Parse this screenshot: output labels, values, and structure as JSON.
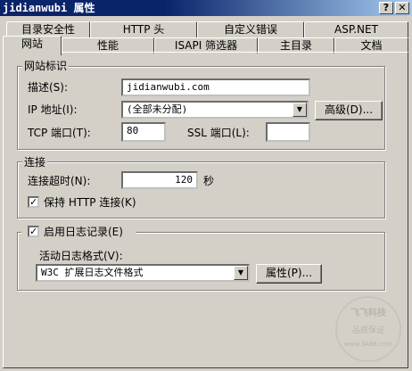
{
  "window": {
    "title": "jidianwubi 属性",
    "help_glyph": "?",
    "close_glyph": "✕"
  },
  "tabs_back": [
    "目录安全性",
    "HTTP 头",
    "自定义错误",
    "ASP.NET"
  ],
  "tabs_front": [
    "网站",
    "性能",
    "ISAPI 筛选器",
    "主目录",
    "文档"
  ],
  "website_id": {
    "legend": "网站标识",
    "desc_label": "描述(S):",
    "desc_value": "jidianwubi.com",
    "ip_label": "IP 地址(I):",
    "ip_value": "(全部未分配)",
    "advanced_button": "高级(D)...",
    "tcp_label": "TCP 端口(T):",
    "tcp_value": "80",
    "ssl_label": "SSL 端口(L):",
    "ssl_value": ""
  },
  "connections": {
    "legend": "连接",
    "timeout_label": "连接超时(N):",
    "timeout_value": "120",
    "timeout_unit": "秒",
    "keepalive_label": "保持 HTTP 连接(K)",
    "keepalive_checked": true
  },
  "logging": {
    "enable_label": "启用日志记录(E)",
    "enable_checked": true,
    "format_label": "活动日志格式(V):",
    "format_value": "W3C 扩展日志文件格式",
    "properties_button": "属性(P)..."
  },
  "watermark": {
    "top": "飞飞科技",
    "middle": "品质保证",
    "bottom": "www.3A88.com"
  }
}
